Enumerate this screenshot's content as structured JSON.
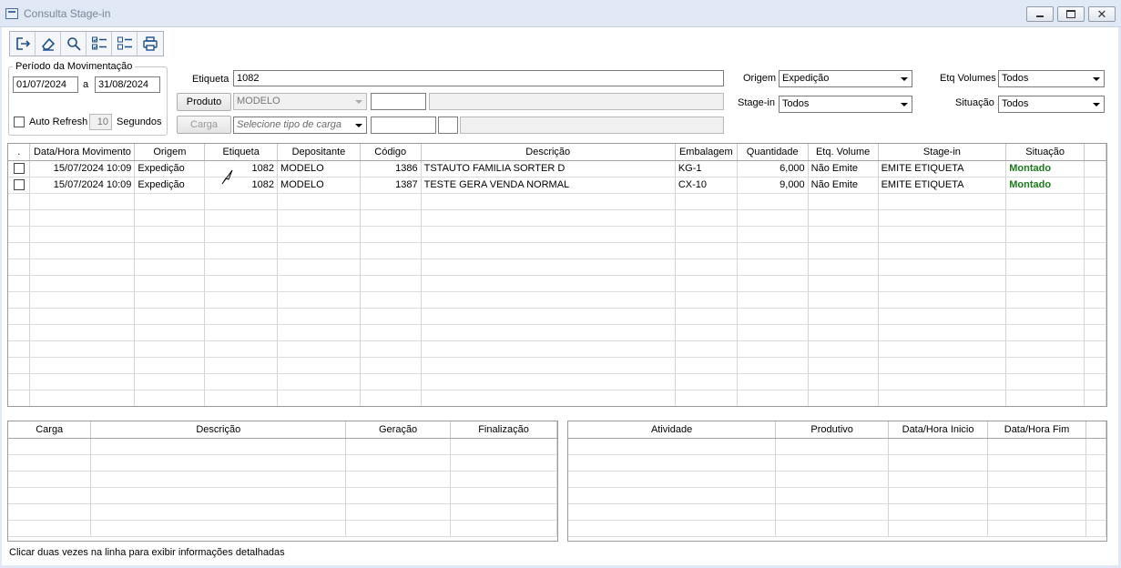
{
  "window": {
    "title": "Consulta Stage-in",
    "minimize_label": "",
    "maximize_label": "",
    "close_label": "✕"
  },
  "toolbar": {
    "buttons": [
      {
        "icon": "exit-icon"
      },
      {
        "icon": "eraser-icon"
      },
      {
        "icon": "search-icon"
      },
      {
        "icon": "check-all-icon"
      },
      {
        "icon": "uncheck-all-icon"
      },
      {
        "icon": "print-icon"
      }
    ]
  },
  "periodo": {
    "legend": "Período da Movimentação",
    "from": "01/07/2024",
    "sep": "a",
    "to": "31/08/2024",
    "auto_refresh_label": "Auto Refresh",
    "seconds_value": "10",
    "seconds_label": "Segundos"
  },
  "filters": {
    "etiqueta_label": "Etiqueta",
    "etiqueta_value": "1082",
    "produto_button": "Produto",
    "produto_value": "MODELO",
    "carga_button": "Carga",
    "carga_placeholder": "Selecione tipo de carga",
    "origem_label": "Origem",
    "origem_value": "Expedição",
    "stagein_label": "Stage-in",
    "stagein_value": "Todos",
    "etq_volumes_label": "Etq Volumes",
    "etq_volumes_value": "Todos",
    "situacao_label": "Situação",
    "situacao_value": "Todos"
  },
  "main_grid": {
    "headers": [
      ".",
      "Data/Hora Movimento",
      "Origem",
      "Etiqueta",
      "Depositante",
      "Código",
      "Descrição",
      "Embalagem",
      "Quantidade",
      "Etq. Volume",
      "Stage-in",
      "Situação"
    ],
    "rows": [
      [
        "15/07/2024 10:09",
        "Expedição",
        "1082",
        "MODELO",
        "1386",
        "TSTAUTO FAMILIA SORTER D",
        "KG-1",
        "6,000",
        "Não Emite",
        "EMITE ETIQUETA",
        "Montado"
      ],
      [
        "15/07/2024 10:09",
        "Expedição",
        "1082",
        "MODELO",
        "1387",
        "TESTE GERA VENDA NORMAL",
        "CX-10",
        "9,000",
        "Não Emite",
        "EMITE ETIQUETA",
        "Montado"
      ]
    ],
    "situacao_color": "#1a7a1a"
  },
  "carga_grid": {
    "headers": [
      "Carga",
      "Descrição",
      "Geração",
      "Finalização"
    ]
  },
  "atividade_grid": {
    "headers": [
      "Atividade",
      "Produtivo",
      "Data/Hora Inicio",
      "Data/Hora Fim"
    ]
  },
  "status_bar": {
    "text": "Clicar duas vezes na linha para exibir informações detalhadas"
  }
}
